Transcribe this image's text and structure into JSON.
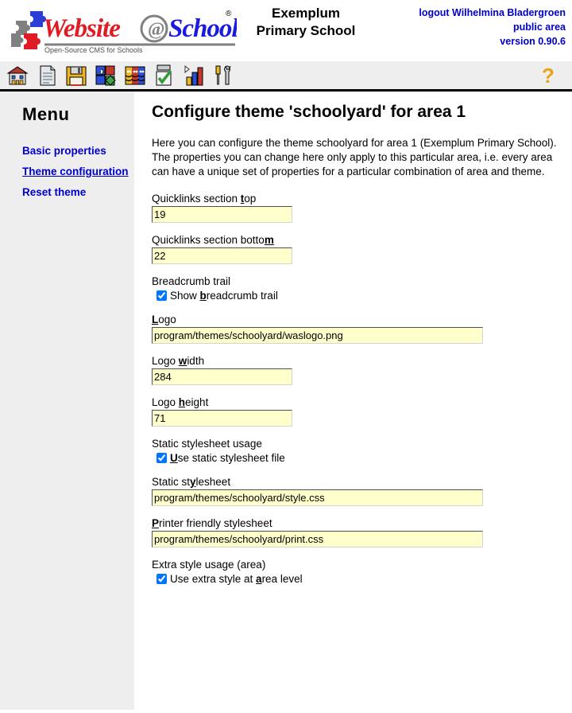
{
  "header": {
    "brand_name": "Website@School",
    "brand_tagline": "Open-Source CMS for Schools",
    "brand_registered": "®",
    "school_name_line1": "Exemplum",
    "school_name_line2": "Primary School",
    "logout_text": "logout Wilhelmina Bladergroen",
    "area_text": "public area",
    "version_text": "version 0.90.6"
  },
  "toolbar": {
    "icons": [
      {
        "name": "home-icon",
        "title": "Home"
      },
      {
        "name": "page-icon",
        "title": "Page"
      },
      {
        "name": "save-icon",
        "title": "Save"
      },
      {
        "name": "modules-icon",
        "title": "Modules"
      },
      {
        "name": "users-icon",
        "title": "Users"
      },
      {
        "name": "tasks-icon",
        "title": "Tasks"
      },
      {
        "name": "statistics-icon",
        "title": "Statistics"
      },
      {
        "name": "tools-icon",
        "title": "Tools"
      }
    ],
    "help": {
      "name": "help-icon",
      "label": "?"
    }
  },
  "sidebar": {
    "title": "Menu",
    "items": [
      {
        "label": "Basic properties",
        "current": false
      },
      {
        "label": "Theme configuration",
        "current": true
      },
      {
        "label": "Reset theme",
        "current": false
      }
    ]
  },
  "main": {
    "title": "Configure theme 'schoolyard' for area 1",
    "intro_line1": "Here you can configure the theme schoolyard for area 1 (Exemplum Primary School).",
    "intro_line2": "The properties you can change here only apply to this particular area, i.e. every area can have a unique set of properties for a particular combination of area and theme.",
    "fields": {
      "quicklinks_top": {
        "label_pre": "Quicklinks section ",
        "label_key": "t",
        "label_post": "op",
        "value": "19"
      },
      "quicklinks_bottom": {
        "label_pre": "Quicklinks section botto",
        "label_key": "m",
        "label_post": "",
        "value": "22"
      },
      "breadcrumb": {
        "group_label": "Breadcrumb trail",
        "check_pre": "Show ",
        "check_key": "b",
        "check_post": "readcrumb trail",
        "checked": true
      },
      "logo": {
        "label_pre": "",
        "label_key": "L",
        "label_post": "ogo",
        "value": "program/themes/schoolyard/waslogo.png"
      },
      "logo_width": {
        "label_pre": "Logo ",
        "label_key": "w",
        "label_post": "idth",
        "value": "284"
      },
      "logo_height": {
        "label_pre": "Logo ",
        "label_key": "h",
        "label_post": "eight",
        "value": "71"
      },
      "static_stylesheet_usage": {
        "group_label": "Static stylesheet usage",
        "check_pre": "",
        "check_key": "U",
        "check_post": "se static stylesheet file",
        "checked": true
      },
      "static_stylesheet": {
        "label_pre": "Static st",
        "label_key": "y",
        "label_post": "lesheet",
        "value": "program/themes/schoolyard/style.css"
      },
      "printer_stylesheet": {
        "label_pre": "",
        "label_key": "P",
        "label_post": "rinter friendly stylesheet",
        "value": "program/themes/schoolyard/print.css"
      },
      "extra_style_area": {
        "group_label": "Extra style usage (area)",
        "check_pre": "Use extra style at ",
        "check_key": "a",
        "check_post": "rea level",
        "checked": true
      }
    }
  },
  "colors": {
    "link": "#0000cc",
    "input_bg": "#ffffcc",
    "sidebar_bg": "#eeeeee",
    "toolbar_bg": "#eeeeee",
    "help_icon": "#e8a317"
  }
}
